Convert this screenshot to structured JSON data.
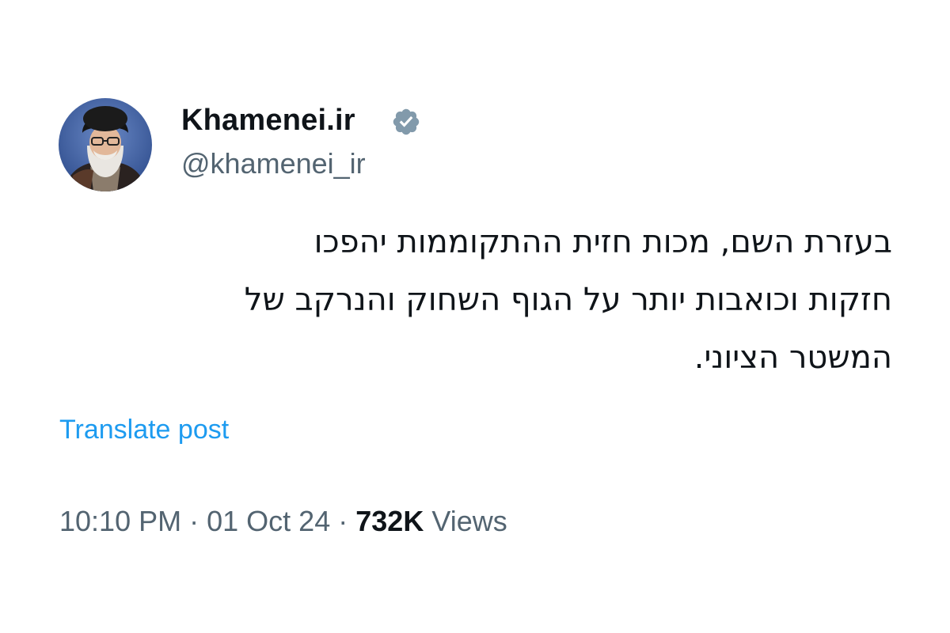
{
  "post": {
    "author": {
      "display_name": "Khamenei.ir",
      "handle": "@khamenei_ir",
      "verified": true,
      "verified_color": "#829aab"
    },
    "text_lines": [
      "בעזרת השם, מכות חזית ההתקוממות יהפכו",
      "חזקות וכואבות יותר על הגוף השחוק והנרקב של",
      "המשטר הציוני."
    ],
    "translate_label": "Translate post",
    "time": "10:10 PM",
    "separator": "·",
    "date": "01 Oct 24",
    "views_count": "732K",
    "views_label": "Views"
  },
  "colors": {
    "text_primary": "#0f1419",
    "text_secondary": "#536471",
    "link": "#1d9bf0"
  }
}
